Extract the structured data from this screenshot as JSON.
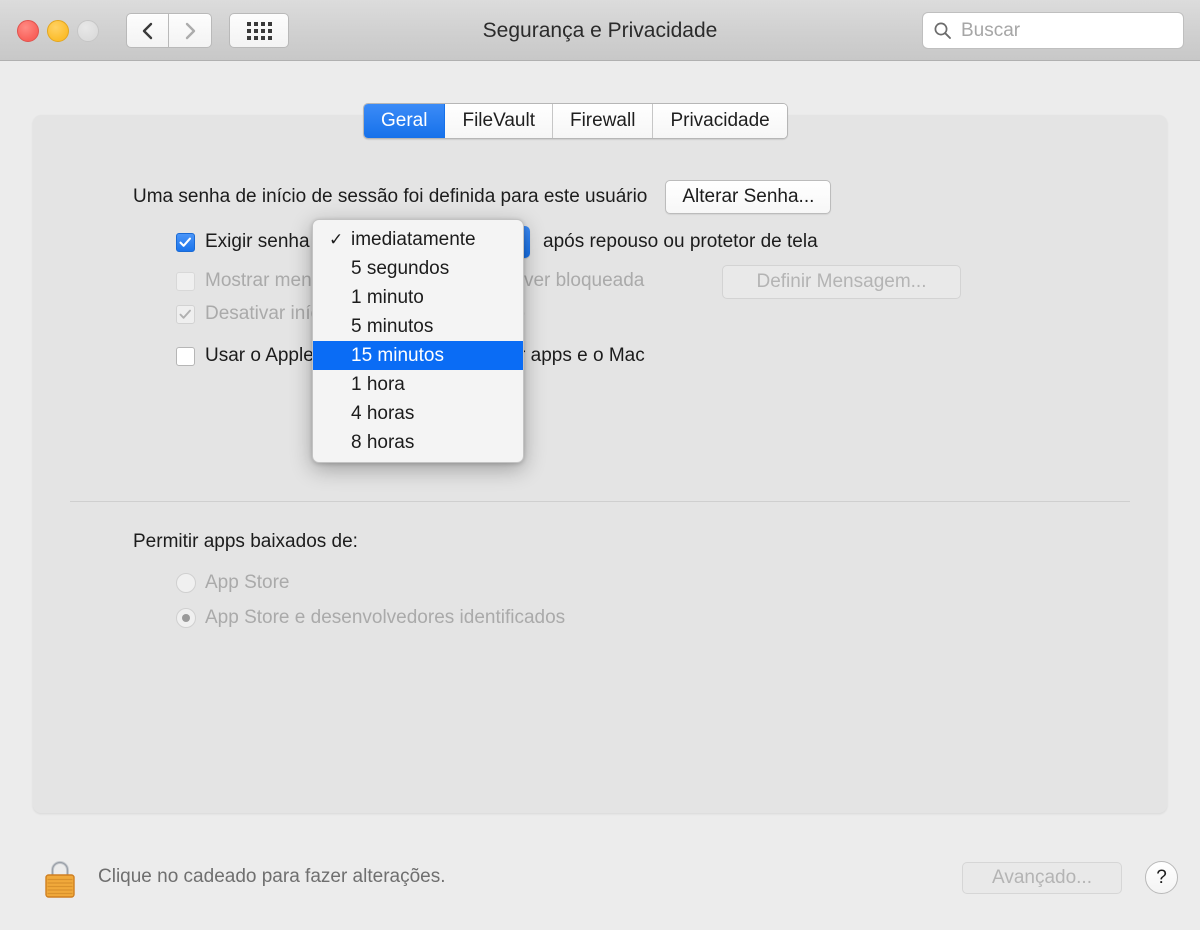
{
  "window": {
    "title": "Segurança e Privacidade",
    "traffic_lights": [
      {
        "name": "close",
        "color": "#f9615a"
      },
      {
        "name": "minimize",
        "color": "#fcbd2c"
      },
      {
        "name": "zoom",
        "color": "#dcdcdc"
      }
    ],
    "nav": {
      "back": "‹",
      "forward": "›",
      "show_all": "grid-icon"
    }
  },
  "search": {
    "placeholder": "Buscar",
    "value": "",
    "icon": "search-icon"
  },
  "tabs": [
    {
      "label": "Geral",
      "active": true
    },
    {
      "label": "FileVault",
      "active": false
    },
    {
      "label": "Firewall",
      "active": false
    },
    {
      "label": "Privacidade",
      "active": false
    }
  ],
  "general": {
    "password_status": "Uma senha de início de sessão foi definida para este usuário",
    "change_password_button": "Alterar Senha...",
    "require_password": {
      "prefix": "Exigir senha",
      "suffix": "após repouso ou protetor de tela",
      "checked": true,
      "popup_value": "15 minutos"
    },
    "show_message": {
      "label": "Mostrar mensagem quando a tela estiver bloqueada",
      "checked": false,
      "enabled": false,
      "button": "Definir Mensagem..."
    },
    "disable_auto_login": {
      "label": "Desativar início de sessão automático",
      "checked": true,
      "enabled": false
    },
    "apple_watch": {
      "label": "Usar o Apple Watch para desbloquear apps e o Mac",
      "checked": false,
      "enabled": true
    },
    "gatekeeper": {
      "title": "Permitir apps baixados de:",
      "options": [
        {
          "label": "App Store",
          "selected": false
        },
        {
          "label": "App Store e desenvolvedores identificados",
          "selected": true
        }
      ]
    }
  },
  "dropdown_menu": {
    "open": true,
    "checked_item": "imediatamente",
    "highlighted_item": "15 minutos",
    "highlight_color": "#0a6cf5",
    "check_glyph": "✓",
    "items": [
      "imediatamente",
      "5 segundos",
      "1 minuto",
      "5 minutos",
      "15 minutos",
      "1 hora",
      "4 horas",
      "8 horas"
    ]
  },
  "bottom_bar": {
    "lock_icon": "lock-closed-icon",
    "note": "Clique no cadeado para fazer alterações.",
    "advanced_button": "Avançado...",
    "help_button": "?"
  }
}
